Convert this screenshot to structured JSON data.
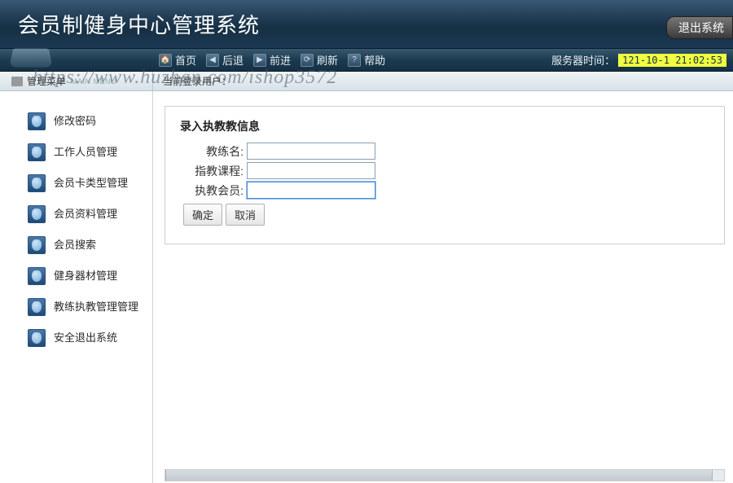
{
  "header": {
    "title": "会员制健身中心管理系统",
    "exit_label": "退出系统"
  },
  "toolbar": {
    "items": [
      {
        "icon": "🏠",
        "label": "首页"
      },
      {
        "icon": "◀",
        "label": "后退"
      },
      {
        "icon": "▶",
        "label": "前进"
      },
      {
        "icon": "⟳",
        "label": "刷新"
      },
      {
        "icon": "?",
        "label": "帮助"
      }
    ],
    "server_time_label": "服务器时间：",
    "server_time_value": "121-10-1 21:02:53"
  },
  "subbar": {
    "left_label": "管理菜单",
    "left_sub": "MAIN MENU",
    "right_label": "当前登录用户："
  },
  "sidebar": {
    "items": [
      {
        "label": "修改密码"
      },
      {
        "label": "工作人员管理"
      },
      {
        "label": "会员卡类型管理"
      },
      {
        "label": "会员资料管理"
      },
      {
        "label": "会员搜索"
      },
      {
        "label": "健身器材管理"
      },
      {
        "label": "教练执教管理管理"
      },
      {
        "label": "安全退出系统"
      }
    ]
  },
  "form": {
    "title": "录入执教教信息",
    "fields": {
      "coach_name": {
        "label": "教练名:",
        "value": ""
      },
      "course": {
        "label": "指教课程:",
        "value": ""
      },
      "member": {
        "label": "执教会员:",
        "value": ""
      }
    },
    "submit": "确定",
    "cancel": "取消"
  },
  "watermark": "https://www.huzhan.com/ishop3572"
}
